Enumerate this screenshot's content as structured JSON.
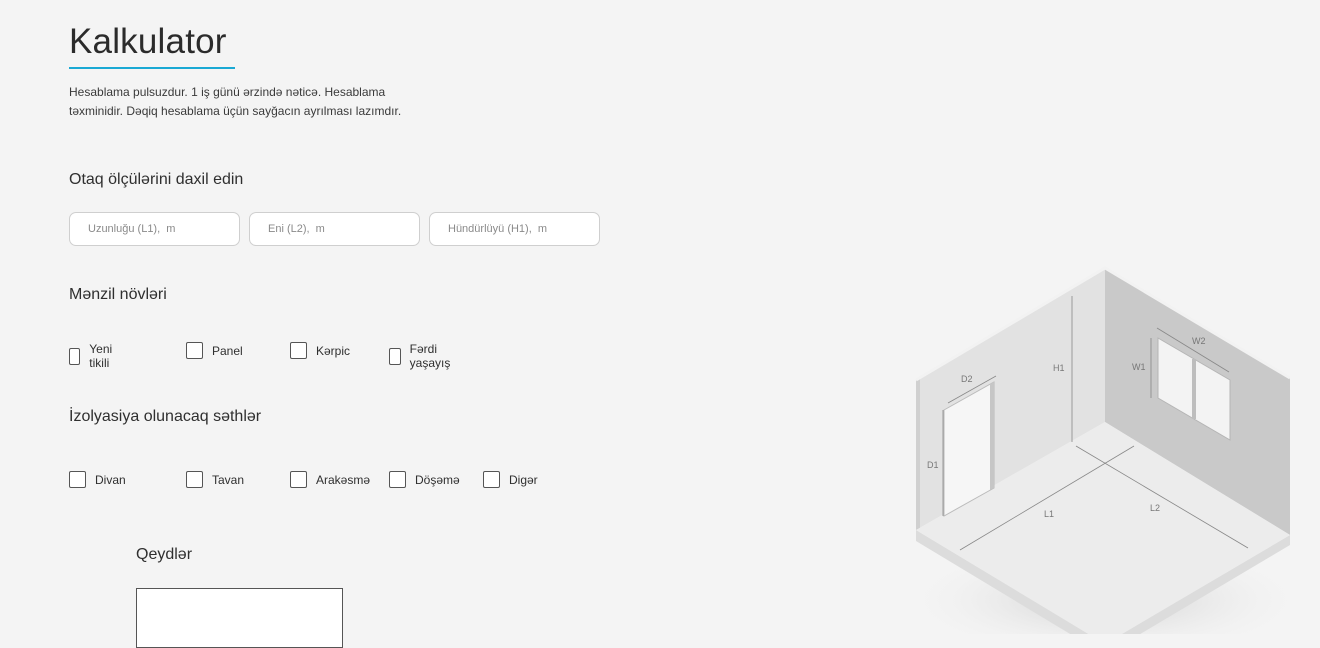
{
  "page": {
    "title": "Kalkulator",
    "intro": "Hesablama pulsuzdur. 1 iş günü ərzində nəticə. Hesablama təxminidir. Dəqiq hesablama üçün sayğacın ayrılması lazımdır."
  },
  "dimensions": {
    "heading": "Otaq ölçülərini daxil edin",
    "length_placeholder": "Uzunluğu (L1),  m",
    "width_placeholder": "Eni (L2),  m",
    "height_placeholder": "Hündürlüyü (H1),  m"
  },
  "apartment_types": {
    "heading": "Mənzil növləri",
    "options": [
      "Yeni tikili",
      "Panel",
      "Kərpic",
      "Fərdi yaşayış"
    ]
  },
  "insulation": {
    "heading": "İzolyasiya olunacaq səthlər",
    "options": [
      "Divan",
      "Tavan",
      "Arakəsmə",
      "Döşəmə",
      "Digər"
    ]
  },
  "notes": {
    "heading": "Qeydlər",
    "value": ""
  },
  "illustration": {
    "labels": {
      "d2": "D2",
      "h1": "H1",
      "w1": "W1",
      "w2": "W2",
      "d1": "D1",
      "l1": "L1",
      "l2": "L2"
    },
    "accent_color": "#1aa9d4"
  }
}
